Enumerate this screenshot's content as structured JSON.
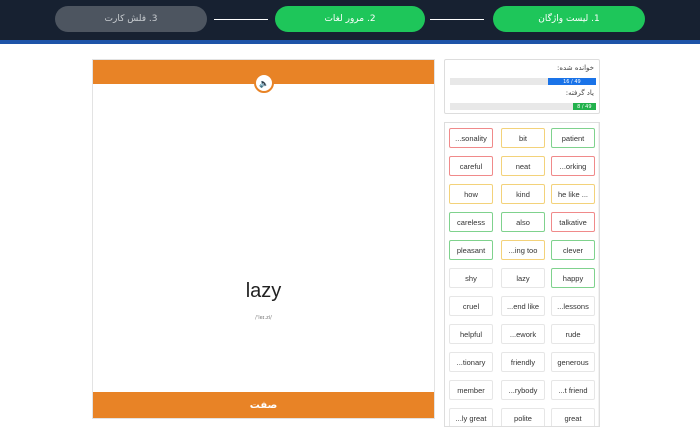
{
  "steps": [
    {
      "label": "1. لیست واژگان",
      "state": "active"
    },
    {
      "label": "2. مرور لغات",
      "state": "active"
    },
    {
      "label": "3. فلش کارت",
      "state": "inactive"
    }
  ],
  "card": {
    "word": "lazy",
    "phonetic": "/ˈleɪ.zi/",
    "audio_icon": "speaker-icon",
    "action_label": "صفت"
  },
  "stats": {
    "read_label": "خوانده شده:",
    "read_value": "16 / 49",
    "read_fraction": 0.33,
    "read_color": "#1a73e8",
    "learned_label": "یاد گرفته:",
    "learned_value": "8 / 49",
    "learned_fraction": 0.16,
    "learned_color": "#22b14c"
  },
  "words": [
    [
      "patient",
      "bit",
      "...sonality"
    ],
    [
      "...orking",
      "neat",
      "careful"
    ],
    [
      "he like ...",
      "kind",
      "how"
    ],
    [
      "talkative",
      "also",
      "careless"
    ],
    [
      "clever",
      "...ing too",
      "pleasant"
    ],
    [
      "happy",
      "lazy",
      "shy"
    ],
    [
      "...lessons",
      "...end like",
      "cruel"
    ],
    [
      "rude",
      "...ework",
      "helpful"
    ],
    [
      "generous",
      "friendly",
      "...tionary"
    ],
    [
      "...t friend",
      "...rybody",
      "member"
    ],
    [
      "great",
      "polite",
      "...ly great"
    ]
  ],
  "word_status": [
    [
      "green",
      "yellow",
      "red"
    ],
    [
      "red",
      "yellow",
      "red"
    ],
    [
      "yellow",
      "yellow",
      "yellow"
    ],
    [
      "red",
      "green",
      "green"
    ],
    [
      "green",
      "yellow",
      "green"
    ],
    [
      "green",
      "gray",
      "gray"
    ],
    [
      "gray",
      "gray",
      "gray"
    ],
    [
      "gray",
      "gray",
      "gray"
    ],
    [
      "gray",
      "gray",
      "gray"
    ],
    [
      "gray",
      "gray",
      "gray"
    ],
    [
      "gray",
      "gray",
      "gray"
    ]
  ],
  "colors": {
    "accent_orange": "#e88326",
    "step_green": "#1ec65a",
    "header_dark": "#172131"
  }
}
